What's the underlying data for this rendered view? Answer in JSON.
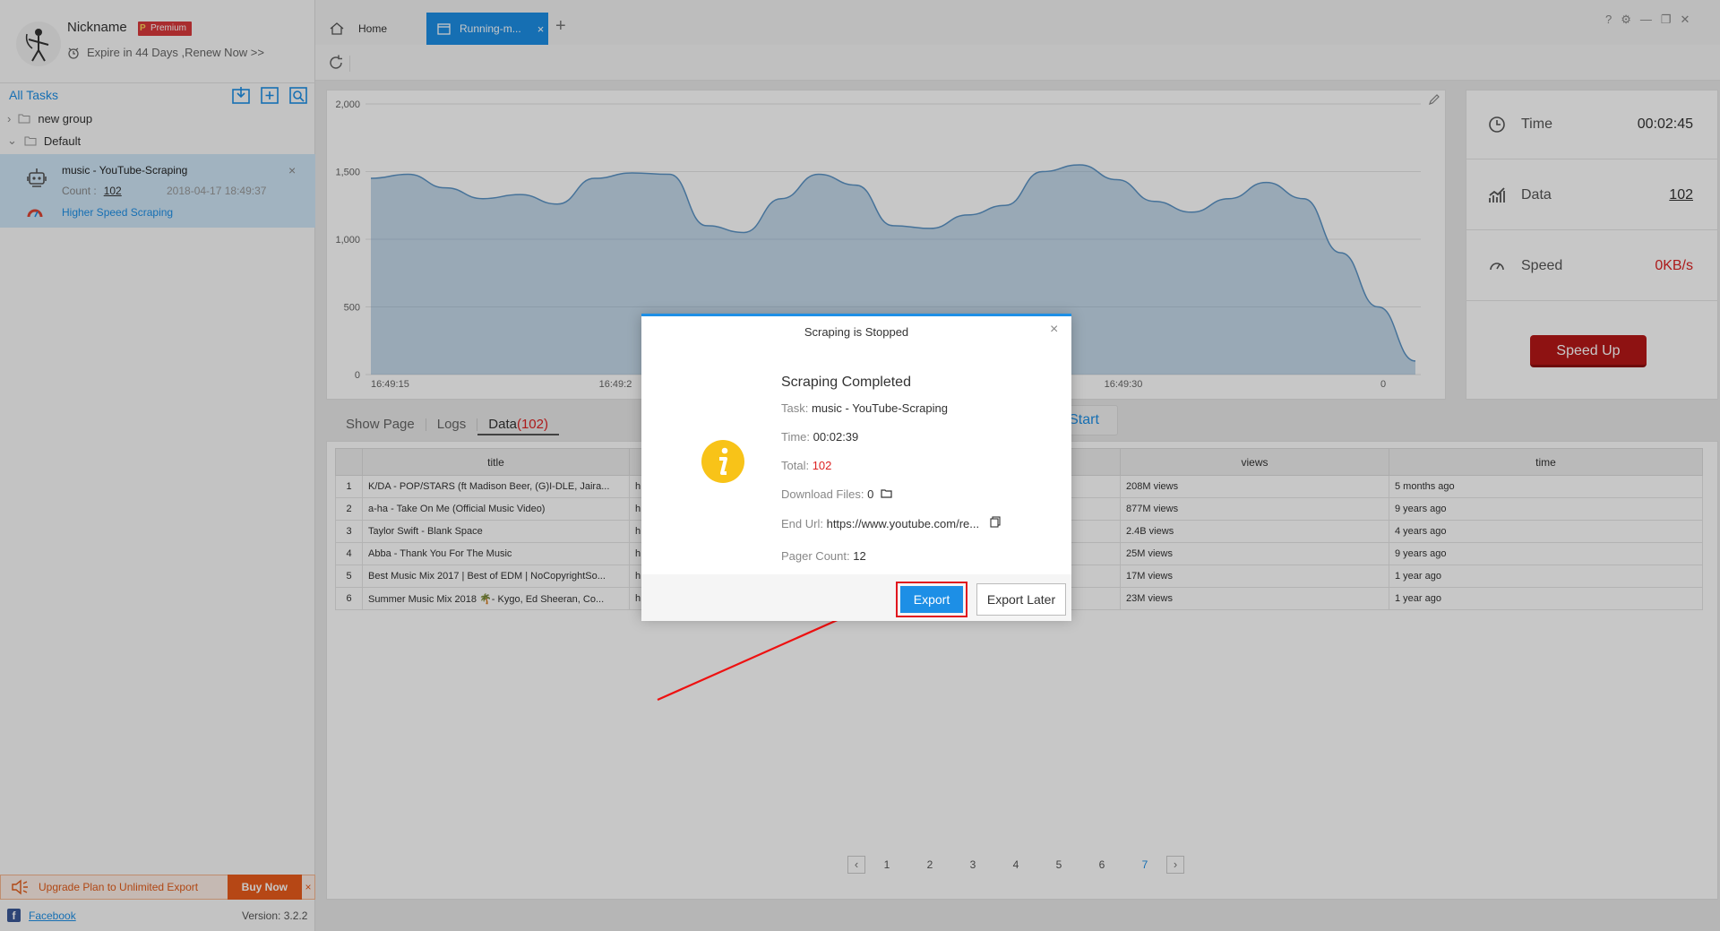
{
  "user": {
    "nickname": "Nickname",
    "badge": "Premium",
    "expire_text": "Expire in 44 Days ,Renew Now >>"
  },
  "sidebar": {
    "all_tasks_label": "All Tasks",
    "groups": [
      {
        "label": "new group",
        "expanded": false
      },
      {
        "label": "Default",
        "expanded": true
      }
    ],
    "task": {
      "name": "music - YouTube-Scraping",
      "count_label": "Count :",
      "count_value": "102",
      "date": "2018-04-17 18:49:37",
      "speed_mode": "Higher Speed Scraping"
    },
    "upgrade_text": "Upgrade Plan to Unlimited Export",
    "buy_now": "Buy Now",
    "facebook_label": "Facebook",
    "version": "Version: 3.2.2"
  },
  "tabs": {
    "home": "Home",
    "running": "Running-m..."
  },
  "stats": {
    "time_label": "Time",
    "time_value": "00:02:45",
    "data_label": "Data",
    "data_value": "102",
    "speed_label": "Speed",
    "speed_value": "0KB/s",
    "speed_up_button": "Speed Up"
  },
  "subtabs": {
    "show_page": "Show Page",
    "logs": "Logs",
    "data": "Data",
    "data_count": "(102)",
    "start": "Start"
  },
  "table": {
    "columns": [
      "",
      "title",
      "",
      "",
      "",
      "views",
      "time"
    ],
    "rows": [
      [
        "1",
        "K/DA - POP/STARS (ft Madison Beer, (G)I-DLE, Jaira...",
        "h",
        "",
        "",
        "208M views",
        "5 months ago"
      ],
      [
        "2",
        "a-ha - Take On Me (Official Music Video)",
        "h",
        "",
        "",
        "877M views",
        "9 years ago"
      ],
      [
        "3",
        "Taylor Swift - Blank Space",
        "h",
        "",
        "",
        "2.4B views",
        "4 years ago"
      ],
      [
        "4",
        "Abba - Thank You For The Music",
        "h",
        "",
        "",
        "25M views",
        "9 years ago"
      ],
      [
        "5",
        "Best Music Mix 2017 | Best of EDM | NoCopyrightSo...",
        "h",
        "",
        "",
        "17M views",
        "1 year ago"
      ],
      [
        "6",
        "Summer Music Mix 2018 🌴- Kygo, Ed Sheeran, Co...",
        "h",
        "",
        "",
        "23M views",
        "1 year ago"
      ]
    ]
  },
  "pager": {
    "pages": [
      "1",
      "2",
      "3",
      "4",
      "5",
      "6",
      "7"
    ],
    "active_page": "7"
  },
  "chart_data": {
    "type": "area",
    "x_tick_labels": [
      "16:49:15",
      "16:49:2",
      "16:49:30",
      "0"
    ],
    "y_tick_labels": [
      "2,000",
      "1,500",
      "1,000",
      "500",
      "0"
    ],
    "ylim": [
      0,
      2000
    ],
    "color": "#5a93c4",
    "series": [
      {
        "values": [
          1450,
          1480,
          1380,
          1300,
          1330,
          1260,
          1450,
          1490,
          1480,
          1100,
          1050,
          1300,
          1480,
          1400,
          1100,
          1080,
          1180,
          1250,
          1500,
          1550,
          1440,
          1280,
          1200,
          1300,
          1420,
          1300,
          900,
          500,
          100
        ]
      }
    ]
  },
  "modal": {
    "title": "Scraping is Stopped",
    "heading": "Scraping Completed",
    "task_label": "Task:",
    "task_value": "music - YouTube-Scraping",
    "time_label": "Time:",
    "time_value": "00:02:39",
    "total_label": "Total:",
    "total_value": "102",
    "download_label": "Download Files:",
    "download_value": "0",
    "end_url_label": "End Url:",
    "end_url_value": "https://www.youtube.com/re...",
    "pager_label": "Pager Count:",
    "pager_value": "12",
    "export_button": "Export",
    "export_later_button": "Export Later"
  },
  "colors": {
    "accent": "#1d8fe6",
    "danger": "#b71818",
    "highlight": "#e1161e"
  }
}
